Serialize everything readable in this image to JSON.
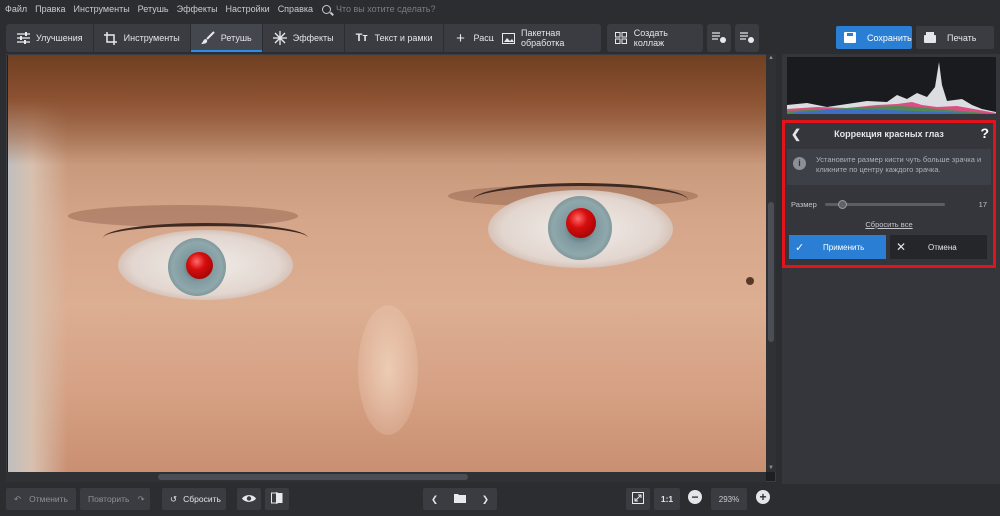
{
  "menu": {
    "items": [
      "Файл",
      "Правка",
      "Инструменты",
      "Ретушь",
      "Эффекты",
      "Настройки",
      "Справка"
    ],
    "search_placeholder": "Что вы хотите сделать?"
  },
  "tabs": [
    {
      "label": "Улучшения",
      "icon": "sliders-icon"
    },
    {
      "label": "Инструменты",
      "icon": "crop-icon"
    },
    {
      "label": "Ретушь",
      "icon": "brush-icon",
      "active": true
    },
    {
      "label": "Эффекты",
      "icon": "sparkle-icon"
    },
    {
      "label": "Текст и рамки",
      "icon": "text-icon"
    },
    {
      "label": "Расширения",
      "icon": "plus-icon"
    }
  ],
  "toolbar": {
    "batch_label": "Пакетная обработка",
    "collage_label": "Создать коллаж",
    "save_label": "Сохранить",
    "print_label": "Печать"
  },
  "panel": {
    "title": "Коррекция красных глаз",
    "help": "?",
    "info_text": "Установите размер кисти чуть больше зрачка и кликните по центру каждого зрачка.",
    "size_label": "Размер",
    "size_value": "17",
    "size_level": 0.14,
    "reset_all": "Сбросить все",
    "apply_label": "Применить",
    "cancel_label": "Отмена"
  },
  "bottom": {
    "undo_label": "Отменить",
    "redo_label": "Повторить",
    "reset_label": "Сбросить",
    "ratio_label": "1:1",
    "zoom_value": "293%"
  },
  "colors": {
    "accent": "#2a7fd4",
    "highlight_border": "#e3131b",
    "background": "#2b2d31"
  }
}
